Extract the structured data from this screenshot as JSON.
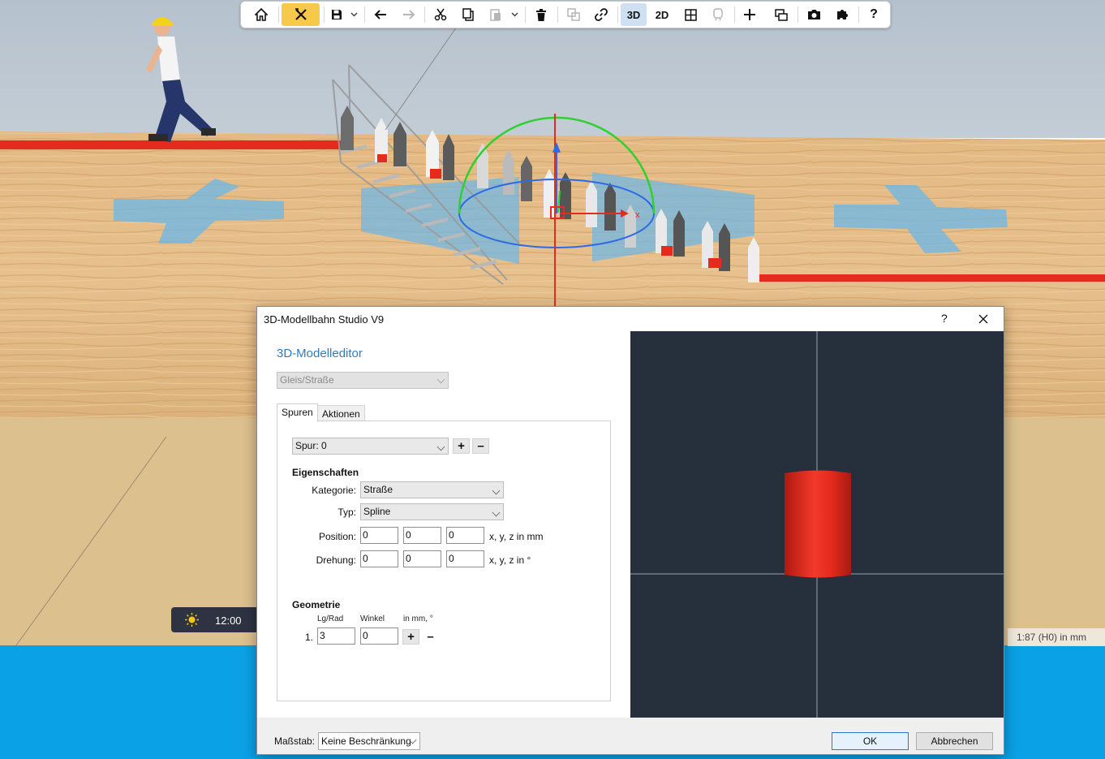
{
  "toolbar": {
    "items": [
      {
        "name": "home-icon"
      },
      {
        "name": "tools-icon",
        "active": true
      },
      {
        "name": "save-icon"
      },
      {
        "name": "undo-icon"
      },
      {
        "name": "redo-icon",
        "disabled": true
      },
      {
        "name": "cut-icon"
      },
      {
        "name": "copy-icon"
      },
      {
        "name": "paste-icon",
        "disabled": true
      },
      {
        "name": "delete-icon"
      },
      {
        "name": "group-icon",
        "disabled": true
      },
      {
        "name": "link-icon"
      },
      {
        "name": "view-3d",
        "label": "3D",
        "active": true
      },
      {
        "name": "view-2d",
        "label": "2D"
      },
      {
        "name": "grid-icon"
      },
      {
        "name": "train-icon",
        "disabled": true
      },
      {
        "name": "add-icon"
      },
      {
        "name": "window-icon"
      },
      {
        "name": "camera-icon"
      },
      {
        "name": "puzzle-icon"
      },
      {
        "name": "help-icon"
      }
    ],
    "label_3d": "3D",
    "label_2d": "2D",
    "label_help": "?"
  },
  "time_widget": {
    "time": "12:00",
    "icon": "sun-icon"
  },
  "scale_info": "1:87 (H0) in mm",
  "dialog": {
    "title": "3D-Modellbahn Studio V9",
    "help": "?",
    "heading": "3D-Modelleditor",
    "type_select": "Gleis/Straße",
    "tabs": [
      "Spuren",
      "Aktionen"
    ],
    "track_select": "Spur: 0",
    "plus": "+",
    "minus": "–",
    "properties": {
      "section": "Eigenschaften",
      "category_label": "Kategorie:",
      "category_value": "Straße",
      "type_label": "Typ:",
      "type_value": "Spline",
      "position_label": "Position:",
      "position_values": [
        "0",
        "0",
        "0"
      ],
      "position_unit": "x, y, z in mm",
      "rotation_label": "Drehung:",
      "rotation_values": [
        "0",
        "0",
        "0"
      ],
      "rotation_unit": "x, y, z in °"
    },
    "geometry": {
      "section": "Geometrie",
      "col_length": "Lg/Rad",
      "col_angle": "Winkel",
      "col_unit": "in mm, °",
      "row_index": "1.",
      "length": "3",
      "angle": "0"
    },
    "footer": {
      "scale_label": "Maßstab:",
      "scale_value": "Keine Beschränkung",
      "ok": "OK",
      "cancel": "Abbrechen"
    }
  },
  "colors": {
    "accent_blue": "#2f7bbf",
    "highlight_yellow": "#f7c94a",
    "preview_bg": "#262f3c",
    "model_red": "#e42a1c"
  }
}
